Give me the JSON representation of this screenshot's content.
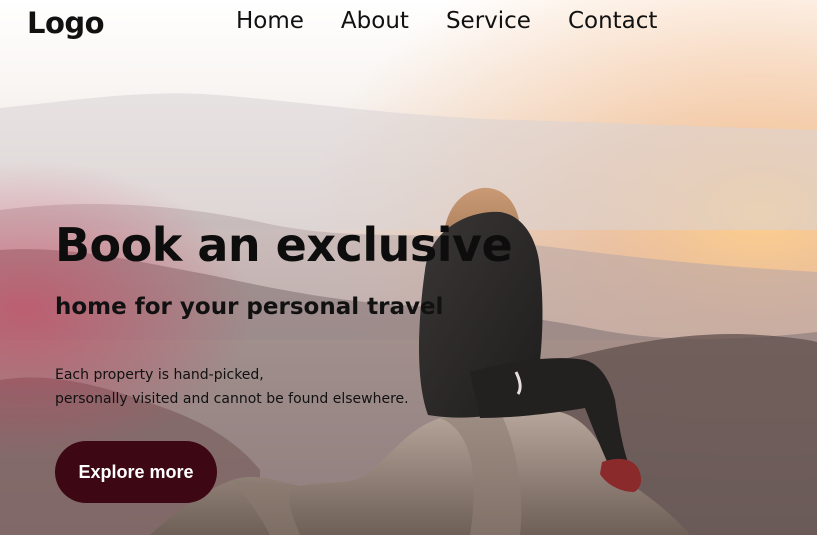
{
  "header": {
    "logo": "Logo",
    "nav": [
      "Home",
      "About",
      "Service",
      "Contact"
    ]
  },
  "hero": {
    "headline": "Book an exclusive",
    "subheadline": "home for your personal travel",
    "description_lines": [
      "Each property is hand-picked,",
      "personally visited and cannot be found elsewhere."
    ],
    "cta_label": "Explore more"
  },
  "colors": {
    "cta_background": "#3d0714",
    "cta_text": "#ffffff",
    "text": "#111111"
  }
}
